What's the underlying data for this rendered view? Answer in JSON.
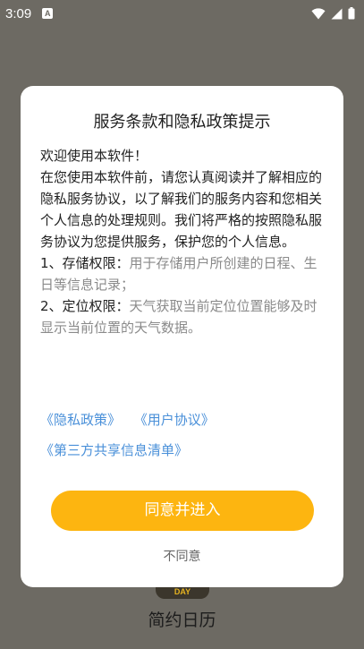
{
  "status_bar": {
    "time": "3:09",
    "notification_icon_letter": "A",
    "icons": [
      "wifi-icon",
      "signal-icon",
      "battery-icon"
    ]
  },
  "background_app": {
    "logo_text": "DAY",
    "app_name": "简约日历"
  },
  "dialog": {
    "title": "服务条款和隐私政策提示",
    "greeting": "欢迎使用本软件！",
    "intro": "在您使用本软件前，请您认真阅读并了解相应的隐私服务协议，以了解我们的服务内容和您相关个人信息的处理规则。我们将严格的按照隐私服务协议为您提供服务，保护您的个人信息。",
    "permissions": [
      {
        "label": "1、存储权限：",
        "desc": "用于存储用户所创建的日程、生日等信息记录；"
      },
      {
        "label": " 2、定位权限：",
        "desc": "天气获取当前定位位置能够及时显示当前位置的天气数据。"
      }
    ],
    "links": {
      "privacy_policy": "《隐私政策》",
      "user_agreement": "《用户协议》",
      "third_party_list": "《第三方共享信息清单》"
    },
    "agree_label": "同意并进入",
    "disagree_label": "不同意"
  },
  "colors": {
    "accent": "#fdb510",
    "link": "#4a90d9",
    "overlay": "#6d6a63"
  }
}
